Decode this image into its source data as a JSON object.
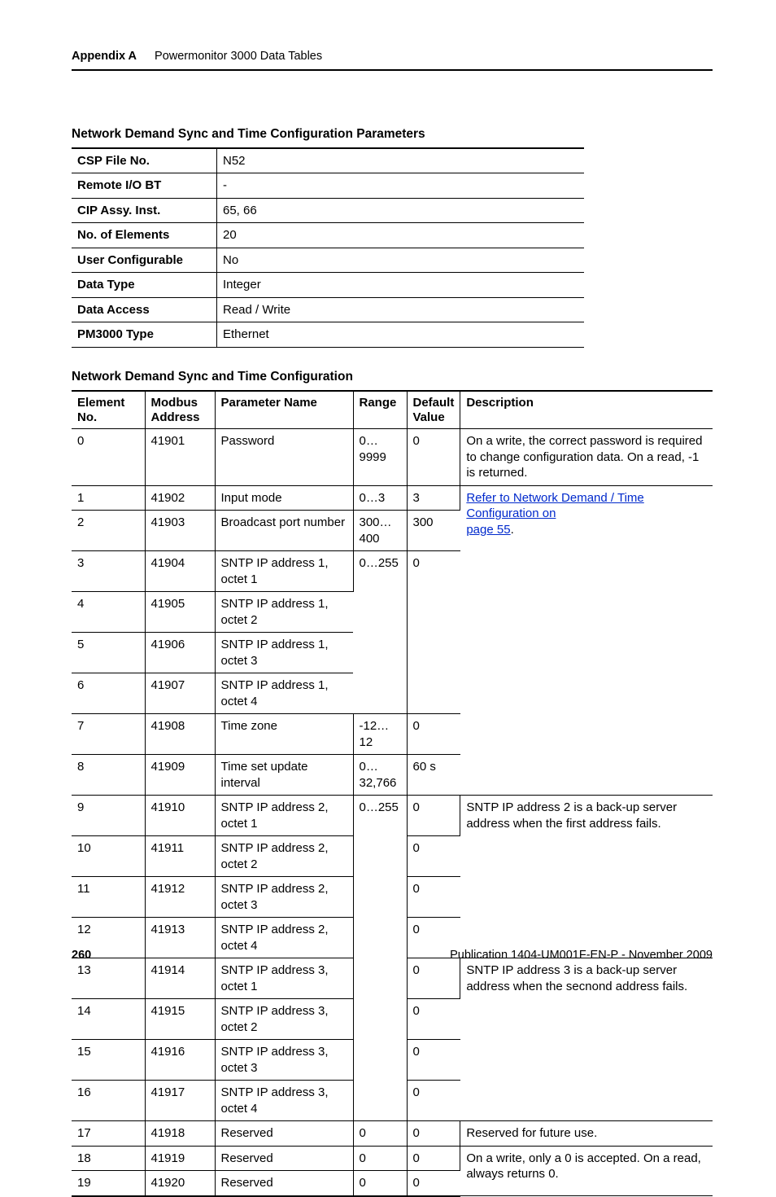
{
  "header": {
    "appendix": "Appendix A",
    "title": "Powermonitor 3000 Data Tables"
  },
  "paramsTitle": "Network Demand Sync and Time Configuration Parameters",
  "params": [
    {
      "label": "CSP File No.",
      "value": "N52"
    },
    {
      "label": "Remote I/O BT",
      "value": "-"
    },
    {
      "label": "CIP Assy. Inst.",
      "value": "65, 66"
    },
    {
      "label": "No. of Elements",
      "value": "20"
    },
    {
      "label": "User Configurable",
      "value": "No"
    },
    {
      "label": "Data Type",
      "value": "Integer"
    },
    {
      "label": "Data Access",
      "value": "Read / Write"
    },
    {
      "label": "PM3000 Type",
      "value": "Ethernet"
    }
  ],
  "configTitle": "Network Demand Sync and Time Configuration",
  "columns": {
    "c0": "Element No.",
    "c1": "Modbus Address",
    "c2": "Parameter Name",
    "c3": "Range",
    "c4": "Default Value",
    "c5": "Description"
  },
  "rows": {
    "r0": {
      "elem": "0",
      "mod": "41901",
      "name": "Password",
      "range": "0…9999",
      "def": "0",
      "desc": "On a write, the correct password is required to change configuration data.  On a read, -1 is returned."
    },
    "r1": {
      "elem": "1",
      "mod": "41902",
      "name": "Input mode",
      "range": "0…3",
      "def": "3"
    },
    "r2": {
      "elem": "2",
      "mod": "41903",
      "name": "Broadcast port number",
      "range": "300…400",
      "def": "300"
    },
    "r3": {
      "elem": "3",
      "mod": "41904",
      "name": "SNTP IP address 1, octet 1",
      "range": "0…255",
      "def": "0"
    },
    "r4": {
      "elem": "4",
      "mod": "41905",
      "name": "SNTP IP address 1, octet 2"
    },
    "r5": {
      "elem": "5",
      "mod": "41906",
      "name": "SNTP IP address 1, octet 3"
    },
    "r6": {
      "elem": "6",
      "mod": "41907",
      "name": "SNTP IP address 1, octet 4"
    },
    "r7": {
      "elem": "7",
      "mod": "41908",
      "name": "Time zone",
      "range": "-12…12",
      "def": "0"
    },
    "r8": {
      "elem": "8",
      "mod": "41909",
      "name": "Time set update interval",
      "range": "0…32,766",
      "def": "60 s"
    },
    "r9": {
      "elem": "9",
      "mod": "41910",
      "name": "SNTP IP address 2, octet 1",
      "range": "0…255",
      "def": "0",
      "desc": "SNTP IP address 2 is a back-up server address when the first address fails."
    },
    "r10": {
      "elem": "10",
      "mod": "41911",
      "name": "SNTP IP address 2, octet 2",
      "def": "0"
    },
    "r11": {
      "elem": "11",
      "mod": "41912",
      "name": "SNTP IP address 2, octet 3",
      "def": "0"
    },
    "r12": {
      "elem": "12",
      "mod": "41913",
      "name": "SNTP IP address 2, octet 4",
      "def": "0"
    },
    "r13": {
      "elem": "13",
      "mod": "41914",
      "name": "SNTP IP address 3, octet 1",
      "def": "0",
      "desc": "SNTP IP address 3 is a back-up server address when the secnond address fails."
    },
    "r14": {
      "elem": "14",
      "mod": "41915",
      "name": "SNTP IP address 3, octet 2",
      "def": "0"
    },
    "r15": {
      "elem": "15",
      "mod": "41916",
      "name": "SNTP IP address 3, octet 3",
      "def": "0"
    },
    "r16": {
      "elem": "16",
      "mod": "41917",
      "name": "SNTP IP address 3, octet 4",
      "def": "0"
    },
    "r17": {
      "elem": "17",
      "mod": "41918",
      "name": "Reserved",
      "range": "0",
      "def": "0",
      "desc": "Reserved for future use."
    },
    "r18": {
      "elem": "18",
      "mod": "41919",
      "name": "Reserved",
      "range": "0",
      "def": "0",
      "desc": "On a write, only a 0 is accepted.  On a read, always returns 0."
    },
    "r19": {
      "elem": "19",
      "mod": "41920",
      "name": "Reserved",
      "range": "0",
      "def": "0"
    }
  },
  "link": {
    "text1": "Refer to Network Demand / Time Configuration on",
    "text2": "page 55",
    "after": "."
  },
  "footer": {
    "page": "260",
    "pub": "Publication 1404-UM001F-EN-P - November 2009"
  }
}
